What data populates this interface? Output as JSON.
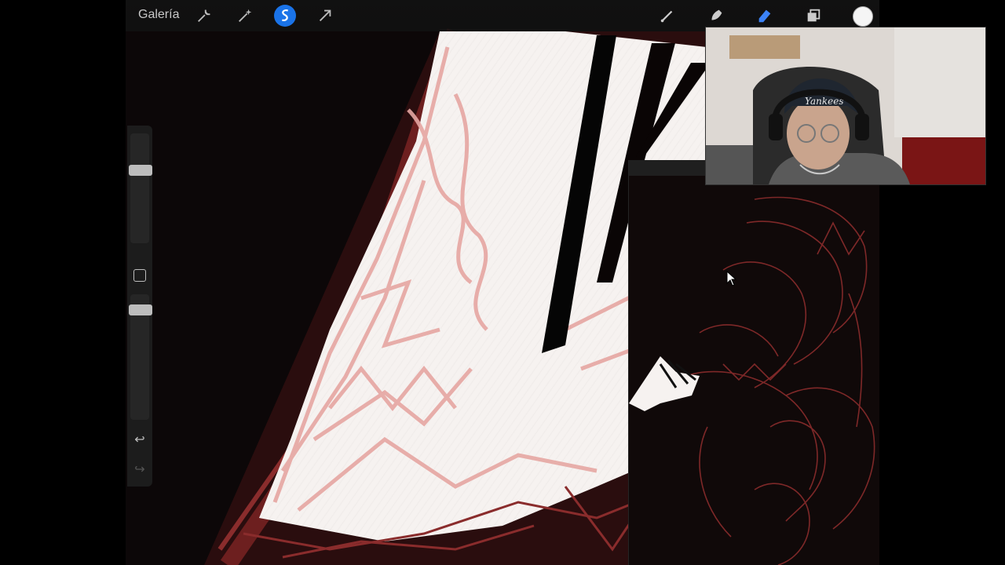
{
  "toolbar": {
    "gallery_label": "Galería",
    "tools": [
      {
        "name": "actions",
        "icon": "wrench-icon"
      },
      {
        "name": "adjustments",
        "icon": "magic-wand-icon"
      },
      {
        "name": "selection",
        "icon": "selection-icon",
        "active": true
      },
      {
        "name": "transform",
        "icon": "arrow-cursor-icon"
      }
    ],
    "right_tools": [
      {
        "name": "brush",
        "icon": "brush-icon"
      },
      {
        "name": "smudge",
        "icon": "smudge-icon"
      },
      {
        "name": "eraser",
        "icon": "eraser-icon",
        "active": true
      },
      {
        "name": "layers",
        "icon": "layers-icon"
      }
    ],
    "color": "#f5f5f5",
    "accent": "#1a73e8"
  },
  "sidebar": {
    "brush_size": "size-slider",
    "opacity": "opacity-slider",
    "undo_icon": "↩",
    "redo_icon": "↪"
  },
  "webcam": {
    "cap_text": "Yankees"
  },
  "colors": {
    "canvas_bg": "#0c0708",
    "sketch_red": "#8a2c2c",
    "skin_pink": "#e6a6a2",
    "highlight_white": "#f6f2f0"
  }
}
